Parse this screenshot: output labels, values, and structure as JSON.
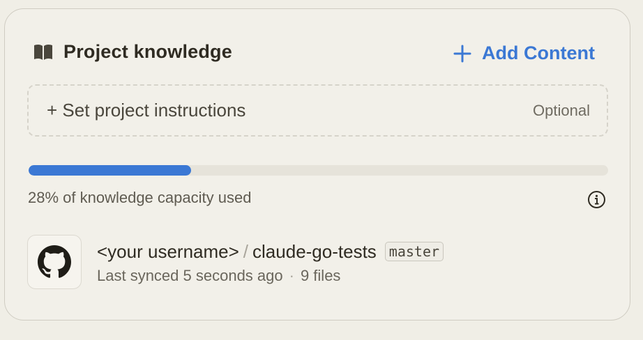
{
  "header": {
    "title": "Project knowledge",
    "icon": "book-icon"
  },
  "add_content": {
    "label": "Add Content",
    "icon": "plus-icon",
    "color": "#3b78d4"
  },
  "instructions": {
    "label": "+ Set project instructions",
    "optional": "Optional"
  },
  "capacity": {
    "percent_used": 28,
    "text": "28% of knowledge capacity used",
    "info_icon": "info-icon"
  },
  "repo": {
    "icon": "github-icon",
    "owner": "<your username>",
    "separator": "/",
    "name": "claude-go-tests",
    "branch": "master",
    "synced": "Last synced 5 seconds ago",
    "dot": "·",
    "files": "9 files"
  }
}
